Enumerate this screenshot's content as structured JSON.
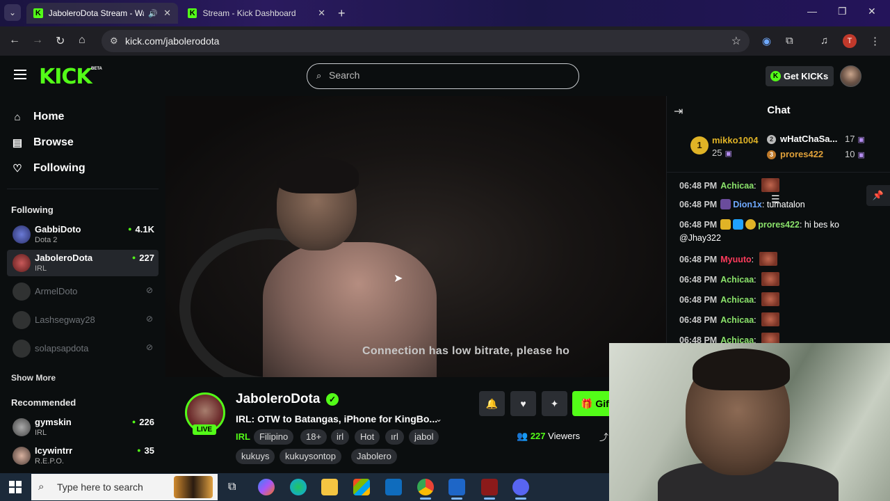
{
  "browser": {
    "tabs": [
      {
        "title": "JaboleroDota Stream - Wat",
        "audio": "🔊",
        "close": "✕"
      },
      {
        "title": "Stream - Kick Dashboard",
        "close": "✕"
      }
    ],
    "new_tab": "+",
    "tab_menu": "⌄",
    "window_controls": [
      "—",
      "❐",
      "✕"
    ],
    "url": "kick.com/jabolerodota",
    "profile_initial": "T"
  },
  "header": {
    "logo": "KICK",
    "logo_beta": "BETA",
    "search_placeholder": "Search",
    "get_kicks": "Get KICKs"
  },
  "sidebar": {
    "nav": [
      {
        "label": "Home",
        "icon": "home-icon"
      },
      {
        "label": "Browse",
        "icon": "browse-icon"
      },
      {
        "label": "Following",
        "icon": "heart-icon"
      }
    ],
    "following_title": "Following",
    "following": [
      {
        "name": "GabbiDoto",
        "category": "Dota 2",
        "viewers": "4.1K",
        "live": true
      },
      {
        "name": "JaboleroDota",
        "category": "IRL",
        "viewers": "227",
        "live": true
      },
      {
        "name": "ArmelDoto",
        "live": false
      },
      {
        "name": "Lashsegway28",
        "live": false
      },
      {
        "name": "solapsapdota",
        "live": false
      }
    ],
    "show_more": "Show More",
    "recommended_title": "Recommended",
    "recommended": [
      {
        "name": "gymskin",
        "category": "IRL",
        "viewers": "226"
      },
      {
        "name": "Icywintrr",
        "category": "R.E.P.O.",
        "viewers": "35"
      }
    ]
  },
  "video": {
    "overlay_text": "Connection has low bitrate, please ho"
  },
  "stream": {
    "name": "JaboleroDota",
    "live_label": "LIVE",
    "title": "IRL: OTW to Batangas, iPhone for KingBo...",
    "category": "IRL",
    "tags": [
      "Filipino",
      "18+",
      "irl",
      "Hot",
      "ırl",
      "jabol",
      "kukuys",
      "kukuysontop",
      "Jabolero"
    ],
    "viewers": "227",
    "viewers_label": "Viewers",
    "gift_label": "Gif"
  },
  "chat": {
    "title": "Chat",
    "leaderboard": {
      "first": {
        "rank": "1",
        "name": "mikko1004",
        "count": "25"
      },
      "second": {
        "rank": "2",
        "name": "wHatChaSa...",
        "count": "17"
      },
      "third": {
        "rank": "3",
        "name": "prores422",
        "count": "10"
      }
    },
    "messages": [
      {
        "time": "06:48 PM",
        "user": "Achicaa",
        "color": "#8be36b",
        "text": "",
        "emote": true
      },
      {
        "time": "06:48 PM",
        "user": "Dion1x",
        "color": "#6fa9ff",
        "text": "tumatalon",
        "emote": false
      },
      {
        "time": "06:48 PM",
        "user": "prores422",
        "color": "#8be36b",
        "text": "hi bes ko @Jhay322",
        "emote": false
      },
      {
        "time": "06:48 PM",
        "user": "Myuuto",
        "color": "#ff3b5c",
        "text": "",
        "emote": true
      },
      {
        "time": "06:48 PM",
        "user": "Achicaa",
        "color": "#8be36b",
        "text": "",
        "emote": true
      },
      {
        "time": "06:48 PM",
        "user": "Achicaa",
        "color": "#8be36b",
        "text": "",
        "emote": true
      },
      {
        "time": "06:48 PM",
        "user": "Achicaa",
        "color": "#8be36b",
        "text": "",
        "emote": true
      },
      {
        "time": "06:48 PM",
        "user": "Achicaa",
        "color": "#8be36b",
        "text": "",
        "emote": true
      }
    ]
  },
  "taskbar": {
    "search_placeholder": "Type here to search"
  },
  "colors": {
    "accent": "#53fc18",
    "background": "#0b0e0f",
    "gold": "#e0b326"
  }
}
